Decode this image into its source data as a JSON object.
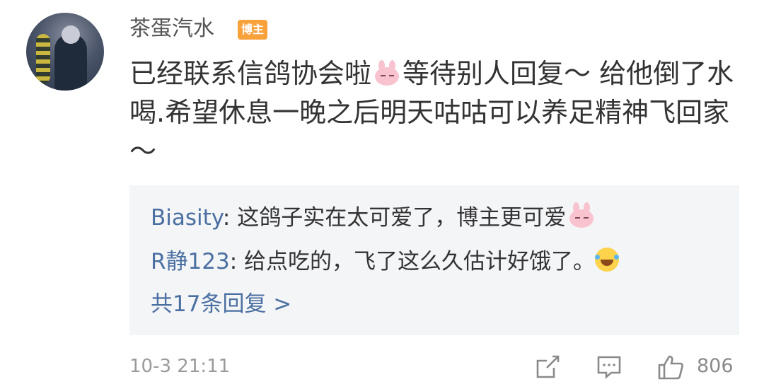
{
  "comment": {
    "username": "茶蛋汽水",
    "badge": "博主",
    "text_part1": "已经联系信鸽协会啦",
    "emoji1": "bunny-emoji",
    "text_part2": "等待别人回复～ 给他倒了水喝.希望休息一晚之后明天咕咕可以养足精神飞回家～",
    "timestamp": "10-3 21:11",
    "like_count": "806"
  },
  "replies": [
    {
      "name": "Biasity",
      "sep": ": ",
      "text": "这鸽子实在太可爱了，博主更可爱",
      "emoji": "bunny-emoji"
    },
    {
      "name": "R静123",
      "sep": ": ",
      "text": "给点吃的，飞了这么久估计好饿了。",
      "emoji": "laughing-crying-emoji"
    }
  ],
  "more_replies": "共17条回复 >",
  "icons": {
    "share": "share-icon",
    "comment": "comment-icon",
    "like": "thumbs-up-icon"
  },
  "colors": {
    "username": "#555555",
    "badge": "#f9a13a",
    "reply_name": "#4a6fa1",
    "reply_bg": "#f4f5f7",
    "meta": "#9a9a9a"
  }
}
